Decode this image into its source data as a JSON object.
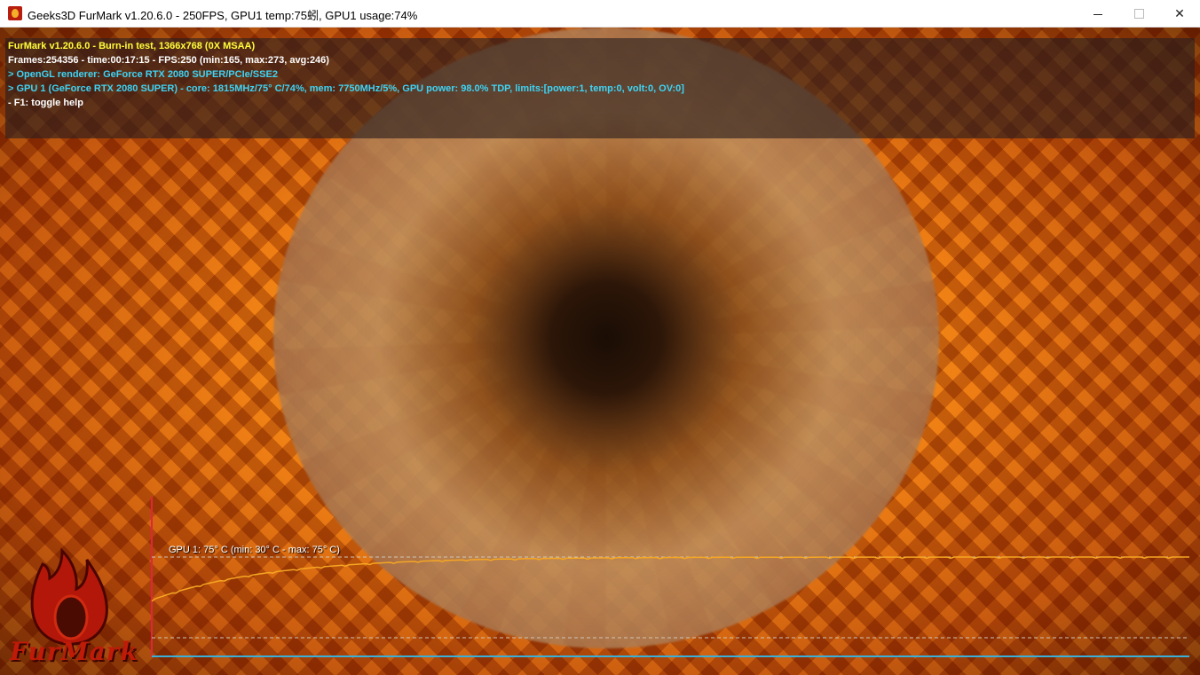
{
  "window": {
    "title": "Geeks3D FurMark v1.20.6.0 - 250FPS, GPU1 temp:75蚓, GPU1 usage:74%",
    "icon": "furmark-app-icon",
    "controls": {
      "minimize_icon": "minimize-icon",
      "maximize_icon": "maximize-icon",
      "close_icon": "close-icon",
      "close_glyph": "✕"
    }
  },
  "hud": {
    "line1": "FurMark v1.20.6.0 - Burn-in test, 1366x768 (0X MSAA)",
    "line2": "Frames:254356 - time:00:17:15 - FPS:250 (min:165, max:273, avg:246)",
    "line3": "> OpenGL renderer: GeForce RTX 2080 SUPER/PCIe/SSE2",
    "line4": "> GPU 1 (GeForce RTX 2080 SUPER) - core: 1815MHz/75° C/74%, mem: 7750MHz/5%, GPU power: 98.0% TDP, limits:[power:1, temp:0, volt:0, OV:0]",
    "line5": "- F1: toggle help",
    "colors": {
      "title": "#ffff3a",
      "stats": "#ffffff",
      "info": "#3ed4f5"
    }
  },
  "logo": {
    "text": "FurMark",
    "icon": "furmark-flame-logo"
  },
  "temp_graph": {
    "label": "GPU 1: 75° C (min: 30° C - max: 75° C)",
    "current_c": 75,
    "min_c": 30,
    "max_c": 75,
    "line_color": "#f5a623",
    "axis_color": "#3ab0d8"
  }
}
